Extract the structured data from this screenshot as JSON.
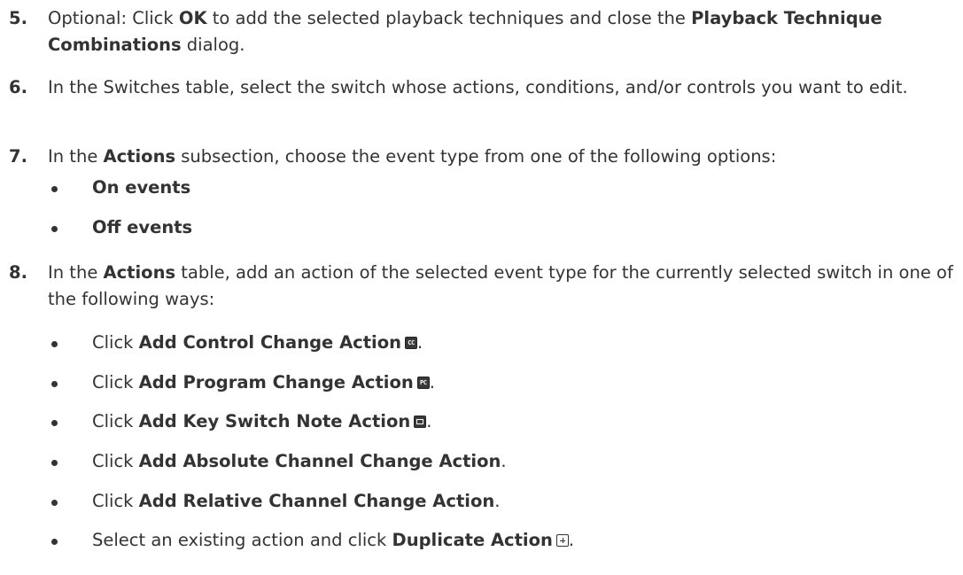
{
  "steps": [
    {
      "num": "5.",
      "parts": [
        {
          "t": "Optional: Click "
        },
        {
          "t": "OK",
          "b": true
        },
        {
          "t": " to add the selected playback techniques and close the "
        },
        {
          "t": "Playback Technique Combinations",
          "b": true
        },
        {
          "t": " dialog."
        }
      ]
    },
    {
      "num": "6.",
      "parts": [
        {
          "t": "In the Switches table, select the switch whose actions, conditions, and/or controls you want to edit."
        }
      ]
    },
    {
      "num": "7.",
      "parts": [
        {
          "t": "In the "
        },
        {
          "t": "Actions",
          "b": true
        },
        {
          "t": " subsection, choose the event type from one of the following options:"
        }
      ],
      "bullets": [
        {
          "parts": [
            {
              "t": "On events",
              "b": true
            }
          ]
        },
        {
          "parts": [
            {
              "t": "Off events",
              "b": true
            }
          ]
        }
      ]
    },
    {
      "num": "8.",
      "parts": [
        {
          "t": "In the "
        },
        {
          "t": "Actions",
          "b": true
        },
        {
          "t": " table, add an action of the selected event type for the currently selected switch in one of the following ways:"
        }
      ],
      "bullets": [
        {
          "parts": [
            {
              "t": "Click "
            },
            {
              "t": "Add Control Change Action",
              "b": true
            }
          ],
          "icon": "control-change-icon",
          "icon_glyph": "CC"
        },
        {
          "parts": [
            {
              "t": "Click "
            },
            {
              "t": "Add Program Change Action",
              "b": true
            }
          ],
          "icon": "program-change-icon",
          "icon_glyph": "PC"
        },
        {
          "parts": [
            {
              "t": "Click "
            },
            {
              "t": "Add Key Switch Note Action",
              "b": true
            }
          ],
          "icon": "key-switch-icon"
        },
        {
          "parts": [
            {
              "t": "Click "
            },
            {
              "t": "Add Absolute Channel Change Action",
              "b": true
            }
          ]
        },
        {
          "parts": [
            {
              "t": "Click "
            },
            {
              "t": "Add Relative Channel Change Action",
              "b": true
            }
          ]
        },
        {
          "parts": [
            {
              "t": "Select an existing action and click "
            },
            {
              "t": "Duplicate Action",
              "b": true
            }
          ],
          "icon": "duplicate-action-icon"
        }
      ]
    }
  ],
  "end_punct": ".",
  "colors": {
    "text": "#333333",
    "icon_bg": "#3a3a3a"
  }
}
